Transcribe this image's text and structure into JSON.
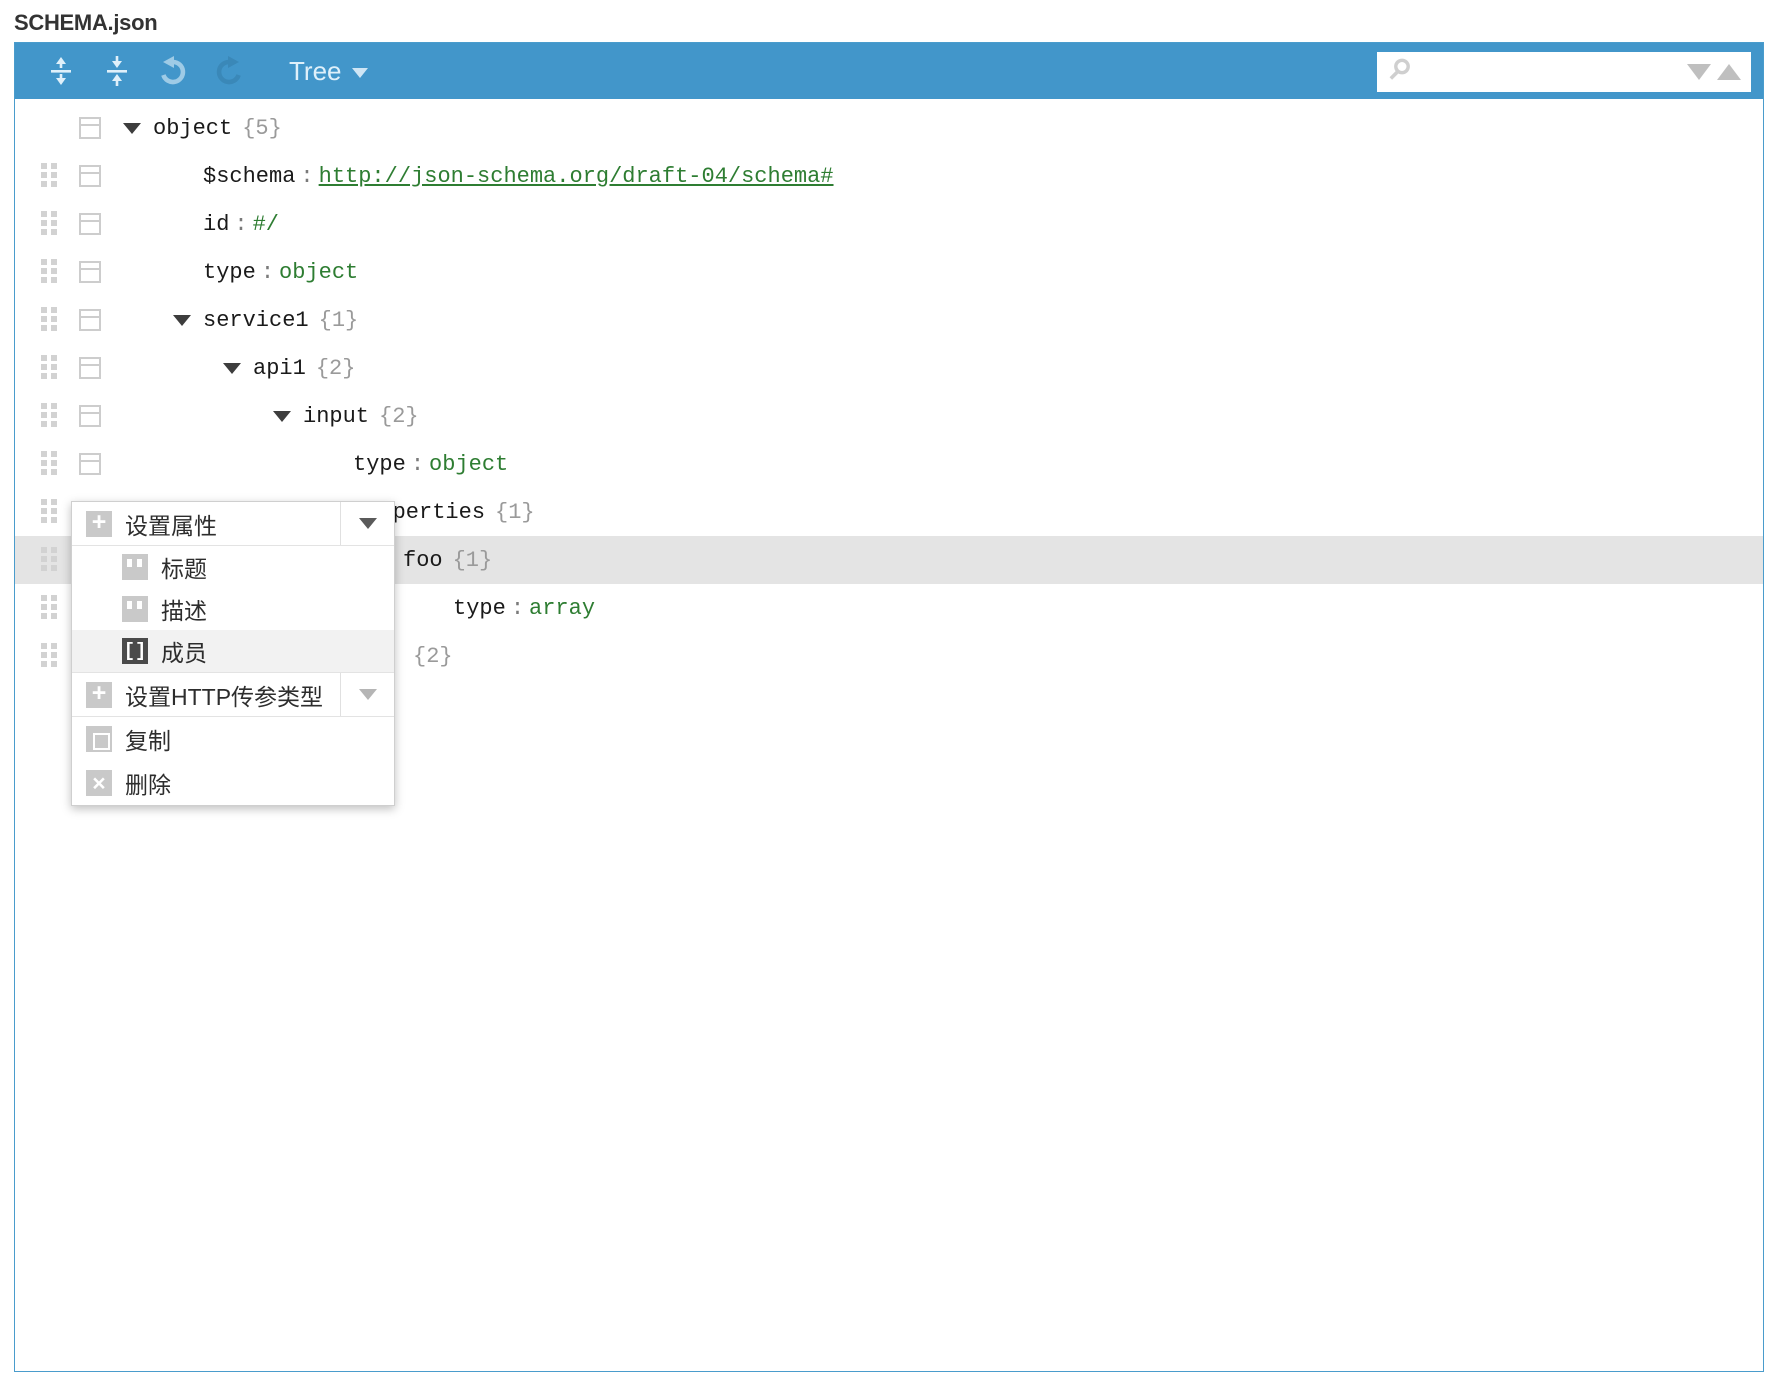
{
  "page_title": "SCHEMA.json",
  "colors": {
    "toolbar_blue": "#4296ca",
    "value_green": "#2e7d32",
    "selected_row": "#e4e4e4",
    "menu_icon_gray": "#c9c9c9"
  },
  "toolbar": {
    "expand_all_tooltip": "Expand all",
    "collapse_all_tooltip": "Collapse all",
    "undo_tooltip": "Undo",
    "redo_tooltip": "Redo",
    "mode_label": "Tree",
    "search": {
      "value": "",
      "placeholder": ""
    }
  },
  "tree": {
    "rows": [
      {
        "indent": 0,
        "expander": true,
        "drag": false,
        "field": "object",
        "sep": "",
        "value": "",
        "count": "{5}",
        "link": false,
        "selected": false
      },
      {
        "indent": 1,
        "expander": false,
        "drag": true,
        "field": "$schema",
        "sep": ":",
        "value": "http://json-schema.org/draft-04/schema#",
        "count": "",
        "link": true,
        "selected": false
      },
      {
        "indent": 1,
        "expander": false,
        "drag": true,
        "field": "id",
        "sep": ":",
        "value": "#/",
        "count": "",
        "link": false,
        "selected": false
      },
      {
        "indent": 1,
        "expander": false,
        "drag": true,
        "field": "type",
        "sep": ":",
        "value": "object",
        "count": "",
        "link": false,
        "selected": false
      },
      {
        "indent": 1,
        "expander": true,
        "drag": true,
        "field": "service1",
        "sep": "",
        "value": "",
        "count": "{1}",
        "link": false,
        "selected": false
      },
      {
        "indent": 2,
        "expander": true,
        "drag": true,
        "field": "api1",
        "sep": "",
        "value": "",
        "count": "{2}",
        "link": false,
        "selected": false
      },
      {
        "indent": 3,
        "expander": true,
        "drag": true,
        "field": "input",
        "sep": "",
        "value": "",
        "count": "{2}",
        "link": false,
        "selected": false
      },
      {
        "indent": 4,
        "expander": false,
        "drag": true,
        "field": "type",
        "sep": ":",
        "value": "object",
        "count": "",
        "link": false,
        "selected": false
      },
      {
        "indent": 4,
        "expander": true,
        "drag": true,
        "field": "properties",
        "sep": "",
        "value": "",
        "count": "{1}",
        "link": false,
        "selected": false
      },
      {
        "indent": 5,
        "expander": true,
        "drag": true,
        "field": "foo",
        "sep": "",
        "value": "",
        "count": "{1}",
        "link": false,
        "selected": true
      },
      {
        "indent": 6,
        "expander": false,
        "drag": true,
        "field": "type",
        "sep": ":",
        "value": "array",
        "count": "",
        "link": false,
        "selected": false
      },
      {
        "indent": 5,
        "expander": true,
        "drag": true,
        "field": "",
        "sep": "",
        "value": "",
        "count": "{2}",
        "link": false,
        "selected": false
      }
    ]
  },
  "context_menu": {
    "items": [
      {
        "id": "set-property",
        "icon": "plus-icon",
        "label": "设置属性",
        "has_expand": true,
        "expand_dim": false
      },
      {
        "id": "set-http-param",
        "icon": "plus-icon",
        "label": "设置HTTP传参类型",
        "has_expand": true,
        "expand_dim": true
      },
      {
        "id": "copy",
        "icon": "copy-icon",
        "label": "复制",
        "has_expand": false,
        "expand_dim": false
      },
      {
        "id": "delete",
        "icon": "close-icon",
        "label": "删除",
        "has_expand": false,
        "expand_dim": false
      }
    ],
    "submenu": [
      {
        "id": "title",
        "icon": "quote-icon",
        "label": "标题",
        "active": false
      },
      {
        "id": "description",
        "icon": "quote-icon",
        "label": "描述",
        "active": false
      },
      {
        "id": "items",
        "icon": "bracket-icon",
        "label": "成员",
        "active": true
      }
    ]
  }
}
